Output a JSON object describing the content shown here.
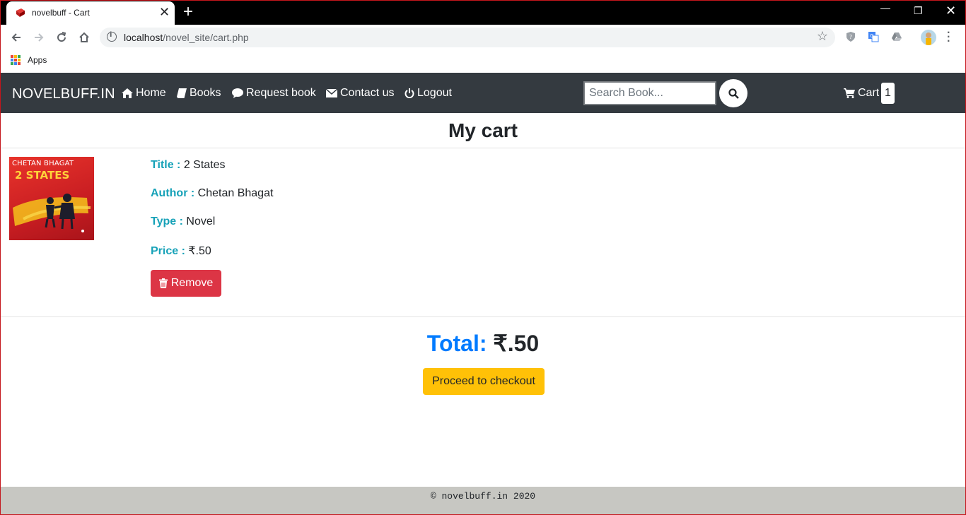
{
  "browser": {
    "tab_title": "novelbuff - Cart",
    "tab_close": "✕",
    "new_tab": "+",
    "url_host": "localhost",
    "url_path": "/novel_site/cart.php",
    "bookmark_label": "Apps",
    "window_min": "—",
    "window_max": "❐",
    "window_close": "✕"
  },
  "navbar": {
    "brand": "NOVELBUFF.IN",
    "links": [
      {
        "label": "Home",
        "icon": "home-icon"
      },
      {
        "label": "Books",
        "icon": "book-icon"
      },
      {
        "label": "Request book",
        "icon": "comment-icon"
      },
      {
        "label": "Contact us",
        "icon": "envelope-icon"
      },
      {
        "label": "Logout",
        "icon": "power-icon"
      }
    ],
    "search_placeholder": "Search Book...",
    "cart_label": "Cart",
    "cart_count": "1"
  },
  "main": {
    "title": "My cart",
    "item": {
      "cover_author": "CHETAN BHAGAT",
      "cover_title": "2 STATES",
      "title_label": "Title :",
      "title_value": "2 States",
      "author_label": "Author :",
      "author_value": "Chetan Bhagat",
      "type_label": "Type :",
      "type_value": "Novel",
      "price_label": "Price :",
      "price_value": "₹.50",
      "remove_label": "Remove"
    },
    "total_label": "Total:",
    "total_value": "₹.50",
    "checkout_label": "Proceed to checkout"
  },
  "footer": {
    "text": "© novelbuff.in 2020"
  },
  "colors": {
    "navbar_bg": "#343a40",
    "label_teal": "#17a2b8",
    "danger": "#dc3545",
    "primary": "#007bff",
    "warning": "#ffc107",
    "footer_bg": "#c7c7c2"
  }
}
